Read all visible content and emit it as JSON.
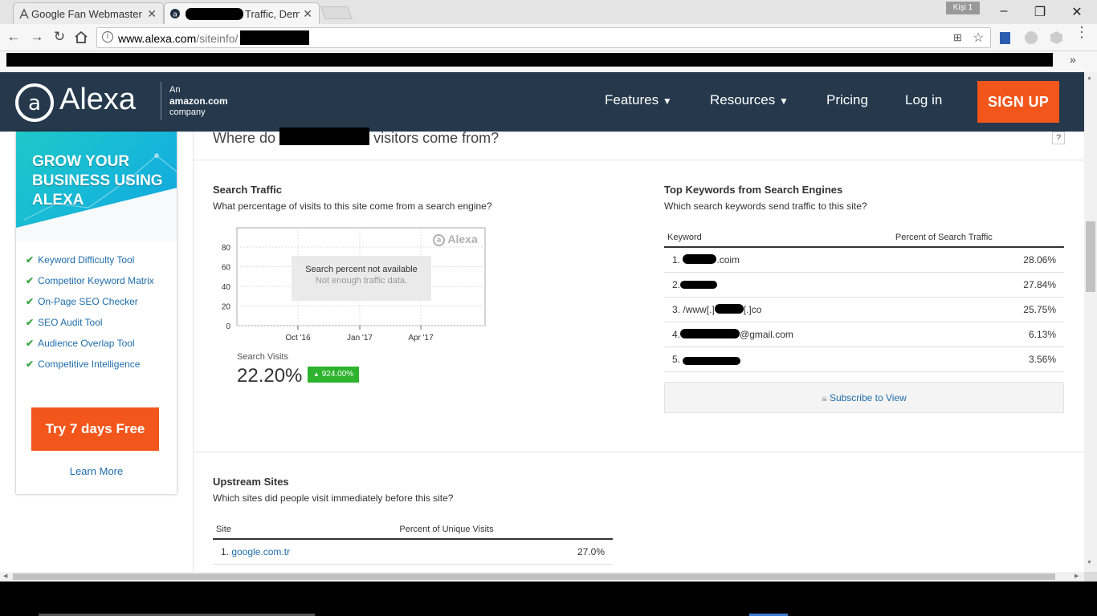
{
  "browser": {
    "tabs": [
      {
        "title": "Google Fan Webmaster F"
      },
      {
        "title": "Traffic, Dem"
      }
    ],
    "profile_label": "Kişi 1",
    "url_host": "www.alexa.com",
    "url_path": "/siteinfo/"
  },
  "navbar": {
    "logo_text": "Alexa",
    "amazon_line1": "An",
    "amazon_line2": "amazon.com",
    "amazon_line3": "company",
    "features": "Features",
    "resources": "Resources",
    "pricing": "Pricing",
    "login": "Log in",
    "signup": "SIGN UP"
  },
  "sidebar": {
    "promo_title": "GROW YOUR BUSINESS USING ALEXA",
    "features": [
      "Keyword Difficulty Tool",
      "Competitor Keyword Matrix",
      "On-Page SEO Checker",
      "SEO Audit Tool",
      "Audience Overlap Tool",
      "Competitive Intelligence"
    ],
    "try_button": "Try 7 days Free",
    "learn_more": "Learn More"
  },
  "section": {
    "title_before": "Where do",
    "title_after": "visitors come from?",
    "help": "?"
  },
  "search_traffic": {
    "title": "Search Traffic",
    "subtitle": "What percentage of visits to this site come from a search engine?",
    "chart_msg1": "Search percent not available",
    "chart_msg2": "Not enough traffic data.",
    "watermark": "Alexa",
    "visits_label": "Search Visits",
    "visits_value": "22.20%",
    "change": "924.00%"
  },
  "chart_data": {
    "type": "line",
    "x_ticks": [
      "Oct '16",
      "Jan '17",
      "Apr '17"
    ],
    "y_ticks": [
      "80",
      "60",
      "40",
      "20",
      "0"
    ],
    "ylim": [
      0,
      80
    ],
    "series": [],
    "grid": true
  },
  "keywords": {
    "title": "Top Keywords from Search Engines",
    "subtitle": "Which search keywords send traffic to this site?",
    "col_keyword": "Keyword",
    "col_percent": "Percent of Search Traffic",
    "rows": [
      {
        "num": "1.",
        "text": ".coim",
        "pct": "28.06%"
      },
      {
        "num": "2.",
        "text": "",
        "pct": "27.84%"
      },
      {
        "num": "3.",
        "text": "/www[.]",
        "text2": "[.]co",
        "pct": "25.75%"
      },
      {
        "num": "4.",
        "text": "@gmail.com",
        "pct": "6.13%"
      },
      {
        "num": "5.",
        "text": "",
        "pct": "3.56%"
      }
    ],
    "subscribe": "Subscribe to View"
  },
  "upstream": {
    "title": "Upstream Sites",
    "subtitle": "Which sites did people visit immediately before this site?",
    "col_site": "Site",
    "col_percent": "Percent of Unique Visits",
    "rows": [
      {
        "num": "1.",
        "site": "google.com.tr",
        "pct": "27.0%"
      }
    ]
  }
}
